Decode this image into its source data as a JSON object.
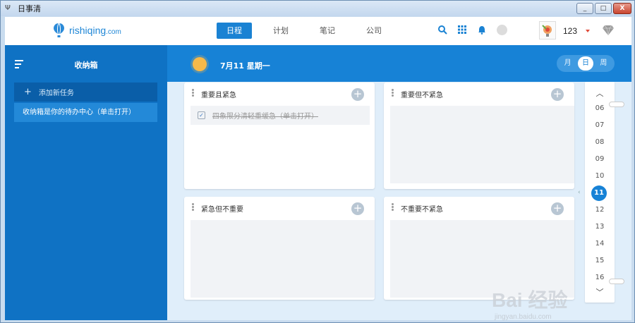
{
  "window": {
    "title": "日事清",
    "minimize": "_",
    "maximize": "□",
    "close": "X"
  },
  "nav": {
    "brand": "rishiqing",
    "brand_suffix": ".com",
    "tabs": [
      "日程",
      "计划",
      "笔记",
      "公司"
    ],
    "active_tab": "日程",
    "username": "123"
  },
  "sidebar": {
    "title": "收纳箱",
    "add_task": "添加新任务",
    "info": "收纳箱是你的待办中心（单击打开）"
  },
  "main": {
    "date": "7月11 星期一",
    "view_toggle": [
      "月",
      "日",
      "周"
    ],
    "active_view": "日"
  },
  "quadrants": [
    {
      "title": "重要且紧急",
      "tasks": [
        {
          "text": "四象限分清轻重缓急（单击打开）",
          "done": true
        }
      ]
    },
    {
      "title": "重要但不紧急",
      "tasks": []
    },
    {
      "title": "紧急但不重要",
      "tasks": []
    },
    {
      "title": "不重要不紧急",
      "tasks": []
    }
  ],
  "hours": [
    "06",
    "07",
    "08",
    "09",
    "10",
    "11",
    "12",
    "13",
    "14",
    "15",
    "16"
  ],
  "active_hour": "11",
  "watermark": {
    "text": "Bai 经验",
    "url": "jingyan.baidu.com"
  },
  "colors": {
    "primary": "#1782d6",
    "sidebar": "#0f72c4",
    "main_bg": "#e0eefa"
  }
}
